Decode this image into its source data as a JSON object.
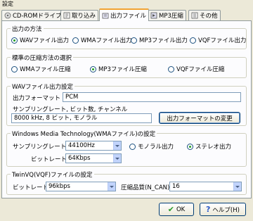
{
  "window": {
    "title": "設定"
  },
  "tabs": [
    {
      "label": "CD-ROMドライブ",
      "icon": "cdrom-icon",
      "active": false
    },
    {
      "label": "取り込み",
      "icon": "import-icon",
      "active": false
    },
    {
      "label": "出力ファイル",
      "icon": "output-file-icon",
      "active": true
    },
    {
      "label": "MP3圧縮",
      "icon": "mp3-icon",
      "active": false
    },
    {
      "label": "その他",
      "icon": "other-icon",
      "active": false
    }
  ],
  "output_method": {
    "legend": "出力の方法",
    "options": [
      "WAVファイル出力",
      "WMAファイル出力",
      "MP3ファイル出力",
      "VQFファイル出力"
    ],
    "selected": "WAVファイル出力"
  },
  "compression_method": {
    "legend": "標準の圧縮方法の選択",
    "options": [
      "WMAファイル圧縮",
      "MP3ファイル圧縮",
      "VQFファイル圧縮"
    ],
    "selected": "MP3ファイル圧縮"
  },
  "wav_settings": {
    "legend": "WAVファイル出力設定",
    "format_label": "出力フォーマット",
    "format_value": "PCM",
    "sampling_label": "サンプリングレート, ビット数, チャンネル",
    "sampling_value": "8000 kHz, 8 ビット, モノラル",
    "change_button": "出力フォーマットの変更"
  },
  "wma_settings": {
    "legend": "Windows Media Technology(WMAファイル)の設定",
    "sampling_label": "サンプリングレート",
    "sampling_value": "44100Hz",
    "bitrate_label": "ビットレート",
    "bitrate_value": "64Kbps",
    "channel_options": [
      "モノラル出力",
      "ステレオ出力"
    ],
    "channel_selected": "ステレオ出力"
  },
  "vqf_settings": {
    "legend": "TwinVQ(VQF)ファイルの設定",
    "bitrate_label": "ビットレート",
    "bitrate_value": "96kbps",
    "quality_label": "圧縮品質(N_CAN)",
    "quality_value": "16"
  },
  "footer": {
    "ok_label": "OK",
    "help_label": "ヘルプ(H)"
  }
}
